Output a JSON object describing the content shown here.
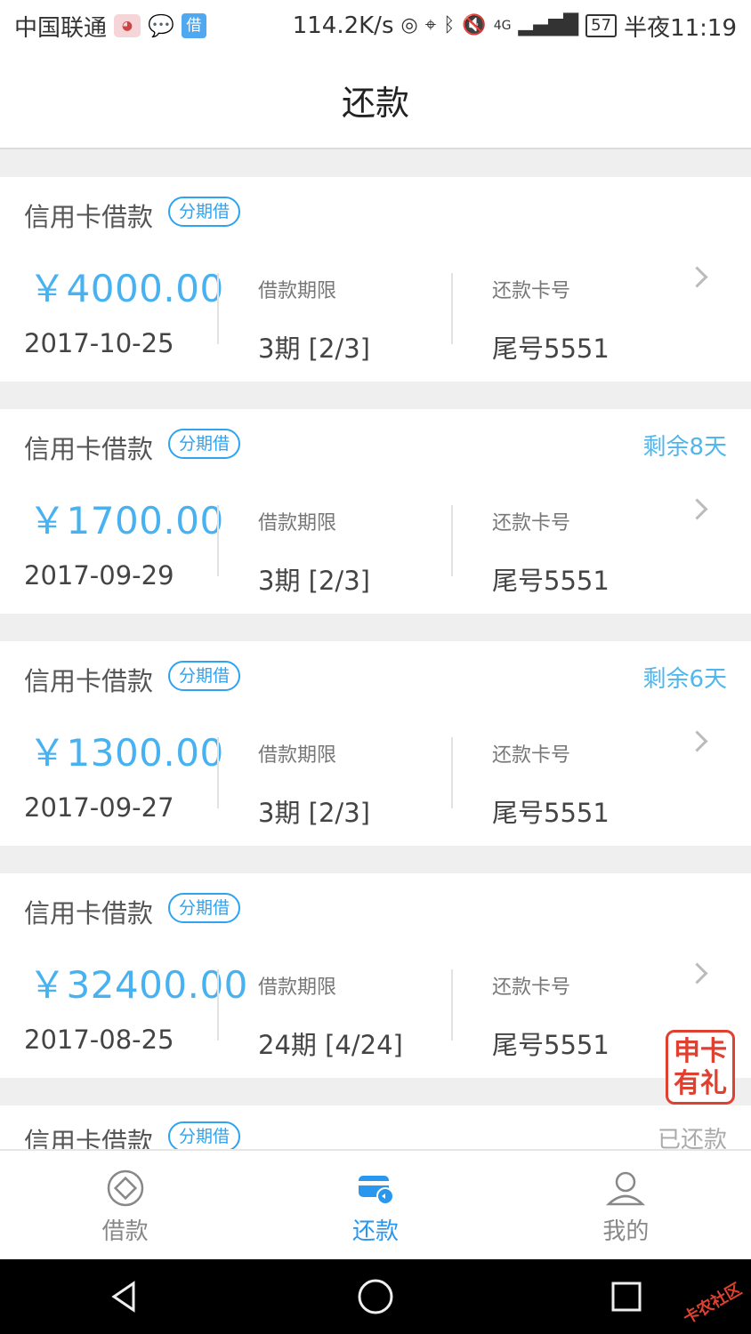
{
  "status_bar": {
    "carrier": "中国联通",
    "app_badge": "借",
    "speed": "114.2K/s",
    "network": "4G",
    "battery": "57",
    "time": "半夜11:19"
  },
  "header": {
    "title": "还款"
  },
  "loans": [
    {
      "title": "信用卡借款",
      "tag": "分期借",
      "remain": "",
      "amount": "￥4000.00",
      "date": "2017-10-25",
      "term_label": "借款期限",
      "term": "3期 [2/3]",
      "card_label": "还款卡号",
      "card": "尾号5551"
    },
    {
      "title": "信用卡借款",
      "tag": "分期借",
      "remain": "剩余8天",
      "amount": "￥1700.00",
      "date": "2017-09-29",
      "term_label": "借款期限",
      "term": "3期 [2/3]",
      "card_label": "还款卡号",
      "card": "尾号5551"
    },
    {
      "title": "信用卡借款",
      "tag": "分期借",
      "remain": "剩余6天",
      "amount": "￥1300.00",
      "date": "2017-09-27",
      "term_label": "借款期限",
      "term": "3期 [2/3]",
      "card_label": "还款卡号",
      "card": "尾号5551"
    },
    {
      "title": "信用卡借款",
      "tag": "分期借",
      "remain": "",
      "amount": "￥32400.00",
      "date": "2017-08-25",
      "term_label": "借款期限",
      "term": "24期 [4/24]",
      "card_label": "还款卡号",
      "card": "尾号5551"
    },
    {
      "title": "信用卡借款",
      "tag": "分期借",
      "remain": "已还款",
      "amount": "",
      "date": "",
      "term_label": "",
      "term": "",
      "card_label": "",
      "card": ""
    }
  ],
  "promo": {
    "line1": "申卡",
    "line2": "有礼"
  },
  "bottom_nav": [
    {
      "label": "借款",
      "icon": "borrow-icon",
      "active": false
    },
    {
      "label": "还款",
      "icon": "repay-card-icon",
      "active": true
    },
    {
      "label": "我的",
      "icon": "profile-icon",
      "active": false
    }
  ],
  "colors": {
    "accent": "#2a97ee",
    "amount": "#48b2f0",
    "promo": "#e04030"
  }
}
